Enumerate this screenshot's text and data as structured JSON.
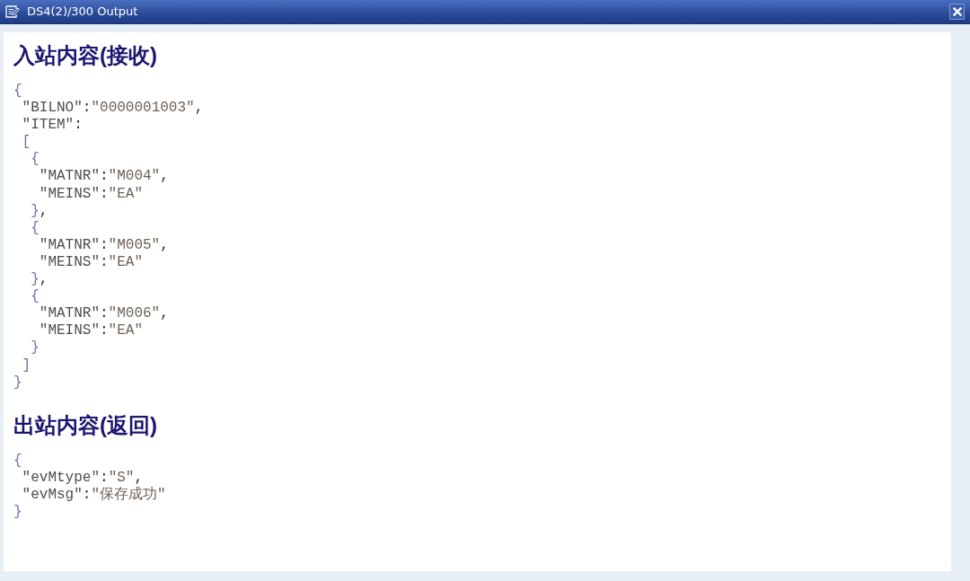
{
  "window": {
    "title": "DS4(2)/300 Output"
  },
  "sections": [
    {
      "heading": "入站内容(接收)",
      "code": [
        {
          "open": [
            {
              "kind": "brace",
              "text": "{"
            }
          ],
          "children": [
            {
              "tokens": [
                {
                  "kind": "key",
                  "text": "\"BILNO\""
                },
                {
                  "kind": "colon",
                  "text": ":"
                },
                {
                  "kind": "value",
                  "text": "\"0000001003\""
                },
                {
                  "kind": "comma",
                  "text": ","
                }
              ]
            },
            {
              "tokens": [
                {
                  "kind": "key",
                  "text": "\"ITEM\""
                },
                {
                  "kind": "colon",
                  "text": ":"
                }
              ]
            },
            {
              "open": [
                {
                  "kind": "brace",
                  "text": "["
                }
              ],
              "children": [
                {
                  "open": [
                    {
                      "kind": "brace",
                      "text": "{"
                    }
                  ],
                  "children": [
                    {
                      "tokens": [
                        {
                          "kind": "key",
                          "text": "\"MATNR\""
                        },
                        {
                          "kind": "colon",
                          "text": ":"
                        },
                        {
                          "kind": "value",
                          "text": "\"M004\""
                        },
                        {
                          "kind": "comma",
                          "text": ","
                        }
                      ]
                    },
                    {
                      "tokens": [
                        {
                          "kind": "key",
                          "text": "\"MEINS\""
                        },
                        {
                          "kind": "colon",
                          "text": ":"
                        },
                        {
                          "kind": "value",
                          "text": "\"EA\""
                        }
                      ]
                    }
                  ],
                  "close": [
                    {
                      "kind": "brace",
                      "text": "}"
                    },
                    {
                      "kind": "comma",
                      "text": ","
                    }
                  ]
                },
                {
                  "open": [
                    {
                      "kind": "brace",
                      "text": "{"
                    }
                  ],
                  "children": [
                    {
                      "tokens": [
                        {
                          "kind": "key",
                          "text": "\"MATNR\""
                        },
                        {
                          "kind": "colon",
                          "text": ":"
                        },
                        {
                          "kind": "value",
                          "text": "\"M005\""
                        },
                        {
                          "kind": "comma",
                          "text": ","
                        }
                      ]
                    },
                    {
                      "tokens": [
                        {
                          "kind": "key",
                          "text": "\"MEINS\""
                        },
                        {
                          "kind": "colon",
                          "text": ":"
                        },
                        {
                          "kind": "value",
                          "text": "\"EA\""
                        }
                      ]
                    }
                  ],
                  "close": [
                    {
                      "kind": "brace",
                      "text": "}"
                    },
                    {
                      "kind": "comma",
                      "text": ","
                    }
                  ]
                },
                {
                  "open": [
                    {
                      "kind": "brace",
                      "text": "{"
                    }
                  ],
                  "children": [
                    {
                      "tokens": [
                        {
                          "kind": "key",
                          "text": "\"MATNR\""
                        },
                        {
                          "kind": "colon",
                          "text": ":"
                        },
                        {
                          "kind": "value",
                          "text": "\"M006\""
                        },
                        {
                          "kind": "comma",
                          "text": ","
                        }
                      ]
                    },
                    {
                      "tokens": [
                        {
                          "kind": "key",
                          "text": "\"MEINS\""
                        },
                        {
                          "kind": "colon",
                          "text": ":"
                        },
                        {
                          "kind": "value",
                          "text": "\"EA\""
                        }
                      ]
                    }
                  ],
                  "close": [
                    {
                      "kind": "brace",
                      "text": "}"
                    }
                  ]
                }
              ],
              "close": [
                {
                  "kind": "brace",
                  "text": "]"
                }
              ]
            }
          ],
          "close": [
            {
              "kind": "brace",
              "text": "}"
            }
          ]
        }
      ]
    },
    {
      "heading": "出站内容(返回)",
      "code": [
        {
          "open": [
            {
              "kind": "brace",
              "text": "{"
            }
          ],
          "children": [
            {
              "tokens": [
                {
                  "kind": "key",
                  "text": "\"evMtype\""
                },
                {
                  "kind": "colon",
                  "text": ":"
                },
                {
                  "kind": "value",
                  "text": "\"S\""
                },
                {
                  "kind": "comma",
                  "text": ","
                }
              ]
            },
            {
              "tokens": [
                {
                  "kind": "key",
                  "text": "\"evMsg\""
                },
                {
                  "kind": "colon",
                  "text": ":"
                },
                {
                  "kind": "value",
                  "text": "\"保存成功\""
                }
              ]
            }
          ],
          "close": [
            {
              "kind": "brace",
              "text": "}"
            }
          ]
        }
      ]
    }
  ]
}
